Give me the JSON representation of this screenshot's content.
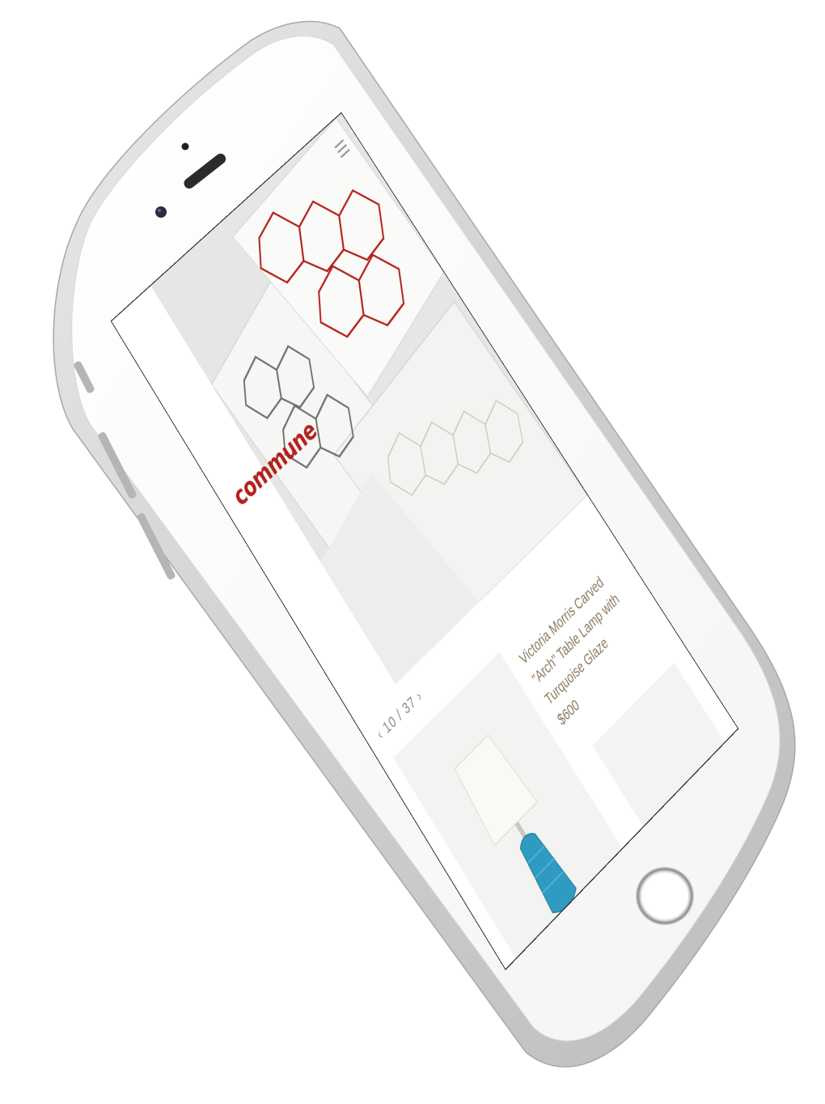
{
  "brand": {
    "logo_text": "commune",
    "logo_color": "#b3211c"
  },
  "header": {
    "menu_icon": "hamburger-menu-icon"
  },
  "carousel": {
    "prev_label": "‹",
    "counter": "10 / 37",
    "next_label": "›"
  },
  "products": [
    {
      "name": "Victoria Morris Carved \"Arch\" Table Lamp with Turquoise Glaze",
      "price": "$600"
    }
  ],
  "colors": {
    "accent": "#b3211c",
    "product_text": "#8b7a5e",
    "lamp_glaze": "#2f9bc2"
  }
}
